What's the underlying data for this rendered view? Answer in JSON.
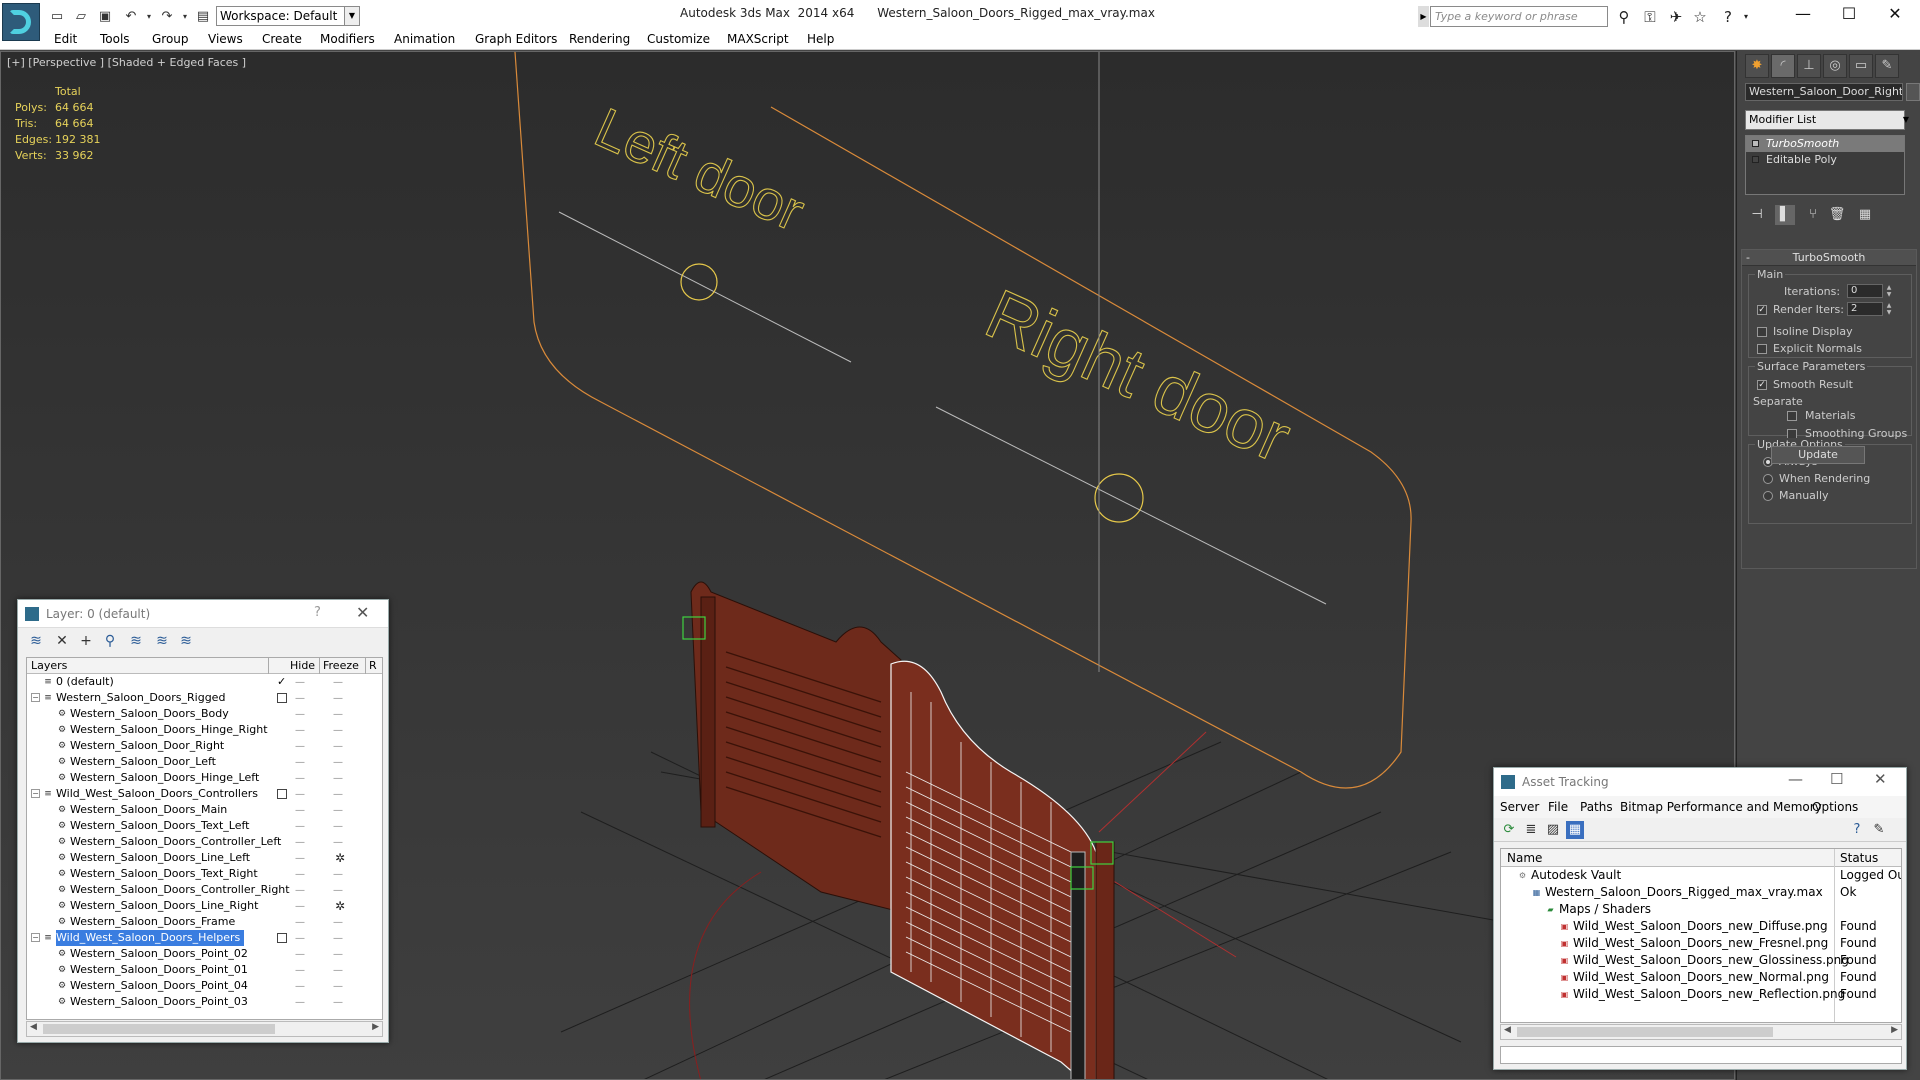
{
  "app": {
    "title": "Autodesk 3ds Max  2014 x64      Western_Saloon_Doors_Rigged_max_vray.max",
    "workspace": "Workspace: Default",
    "search_placeholder": "Type a keyword or phrase"
  },
  "menu": [
    "Edit",
    "Tools",
    "Group",
    "Views",
    "Create",
    "Modifiers",
    "Animation",
    "Graph Editors",
    "Rendering",
    "Customize",
    "MAXScript",
    "Help"
  ],
  "viewport": {
    "label": "[+] [Perspective ] [Shaded + Edged Faces ]",
    "stats": {
      "header": "Total",
      "rows": [
        {
          "k": "Polys:",
          "v": "64 664"
        },
        {
          "k": "Tris:",
          "v": "64 664"
        },
        {
          "k": "Edges:",
          "v": "192 381"
        },
        {
          "k": "Verts:",
          "v": "33 962"
        }
      ]
    },
    "scene_text": {
      "left": "Left door",
      "right": "Right door"
    }
  },
  "command_panel": {
    "object_name": "Western_Saloon_Door_Right",
    "modifier_list": "Modifier List",
    "stack": [
      {
        "label": "TurboSmooth",
        "selected": true
      },
      {
        "label": "Editable Poly",
        "selected": false
      }
    ],
    "rollout_title": "TurboSmooth",
    "main_label": "Main",
    "iterations_label": "Iterations:",
    "iterations_value": "0",
    "render_iters_label": "Render Iters:",
    "render_iters_value": "2",
    "isoline_label": "Isoline Display",
    "explicit_label": "Explicit Normals",
    "surface_label": "Surface Parameters",
    "smooth_result_label": "Smooth Result",
    "separate_label": "Separate",
    "materials_label": "Materials",
    "smoothing_groups_label": "Smoothing Groups",
    "update_options_label": "Update Options",
    "always_label": "Always",
    "when_rendering_label": "When Rendering",
    "manually_label": "Manually",
    "update_button": "Update"
  },
  "layer_window": {
    "title": "Layer: 0 (default)",
    "help": "?",
    "columns": {
      "layers": "Layers",
      "hide": "Hide",
      "freeze": "Freeze",
      "r": "R"
    },
    "rows": [
      {
        "name": "0 (default)",
        "level": 0,
        "type": "layer",
        "current": true
      },
      {
        "name": "Western_Saloon_Doors_Rigged",
        "level": 0,
        "type": "layer",
        "expand": true,
        "box": true
      },
      {
        "name": "Western_Saloon_Doors_Body",
        "level": 1,
        "type": "obj"
      },
      {
        "name": "Western_Saloon_Doors_Hinge_Right",
        "level": 1,
        "type": "obj"
      },
      {
        "name": "Western_Saloon_Door_Right",
        "level": 1,
        "type": "obj"
      },
      {
        "name": "Western_Saloon_Door_Left",
        "level": 1,
        "type": "obj"
      },
      {
        "name": "Western_Saloon_Doors_Hinge_Left",
        "level": 1,
        "type": "obj"
      },
      {
        "name": "Wild_West_Saloon_Doors_Controllers",
        "level": 0,
        "type": "layer",
        "expand": true,
        "box": true
      },
      {
        "name": "Western_Saloon_Doors_Main",
        "level": 1,
        "type": "obj"
      },
      {
        "name": "Western_Saloon_Doors_Text_Left",
        "level": 1,
        "type": "obj"
      },
      {
        "name": "Western_Saloon_Doors_Controller_Left",
        "level": 1,
        "type": "obj"
      },
      {
        "name": "Western_Saloon_Doors_Line_Left",
        "level": 1,
        "type": "obj",
        "frozen": true
      },
      {
        "name": "Western_Saloon_Doors_Text_Right",
        "level": 1,
        "type": "obj"
      },
      {
        "name": "Western_Saloon_Doors_Controller_Right",
        "level": 1,
        "type": "obj"
      },
      {
        "name": "Western_Saloon_Doors_Line_Right",
        "level": 1,
        "type": "obj",
        "frozen": true
      },
      {
        "name": "Western_Saloon_Doors_Frame",
        "level": 1,
        "type": "obj"
      },
      {
        "name": "Wild_West_Saloon_Doors_Helpers",
        "level": 0,
        "type": "layer",
        "expand": true,
        "box": true,
        "selected": true
      },
      {
        "name": "Western_Saloon_Doors_Point_02",
        "level": 1,
        "type": "obj"
      },
      {
        "name": "Western_Saloon_Doors_Point_01",
        "level": 1,
        "type": "obj"
      },
      {
        "name": "Western_Saloon_Doors_Point_04",
        "level": 1,
        "type": "obj"
      },
      {
        "name": "Western_Saloon_Doors_Point_03",
        "level": 1,
        "type": "obj"
      }
    ]
  },
  "asset_window": {
    "title": "Asset Tracking",
    "menu": [
      "Server",
      "File",
      "Paths",
      "Bitmap Performance and Memory",
      "Options"
    ],
    "columns": {
      "name": "Name",
      "status": "Status"
    },
    "rows": [
      {
        "name": "Autodesk Vault",
        "level": 0,
        "status": "Logged Out",
        "icon": "vault"
      },
      {
        "name": "Western_Saloon_Doors_Rigged_max_vray.max",
        "level": 1,
        "status": "Ok",
        "icon": "max"
      },
      {
        "name": "Maps / Shaders",
        "level": 2,
        "status": "",
        "icon": "maps"
      },
      {
        "name": "Wild_West_Saloon_Doors_new_Diffuse.png",
        "level": 3,
        "status": "Found",
        "icon": "png"
      },
      {
        "name": "Wild_West_Saloon_Doors_new_Fresnel.png",
        "level": 3,
        "status": "Found",
        "icon": "png"
      },
      {
        "name": "Wild_West_Saloon_Doors_new_Glossiness.png",
        "level": 3,
        "status": "Found",
        "icon": "png"
      },
      {
        "name": "Wild_West_Saloon_Doors_new_Normal.png",
        "level": 3,
        "status": "Found",
        "icon": "png"
      },
      {
        "name": "Wild_West_Saloon_Doors_new_Reflection.png",
        "level": 3,
        "status": "Found",
        "icon": "png"
      }
    ]
  },
  "colors": {
    "stats_text": "#e6d25a",
    "shape_outline": "#d98a3a",
    "door_wood": "#7a2e1e",
    "selection": "#3a7de0"
  }
}
